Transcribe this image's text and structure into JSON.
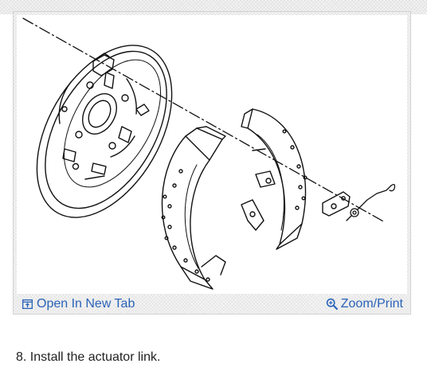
{
  "figure": {
    "open_tab_label": "Open In New Tab",
    "zoom_label": "Zoom/Print",
    "icons": {
      "open_tab": "open-in-new-tab-icon",
      "zoom": "magnifier-icon"
    },
    "link_color": "#2a63b8"
  },
  "step": {
    "text": "8. Install the actuator link."
  }
}
